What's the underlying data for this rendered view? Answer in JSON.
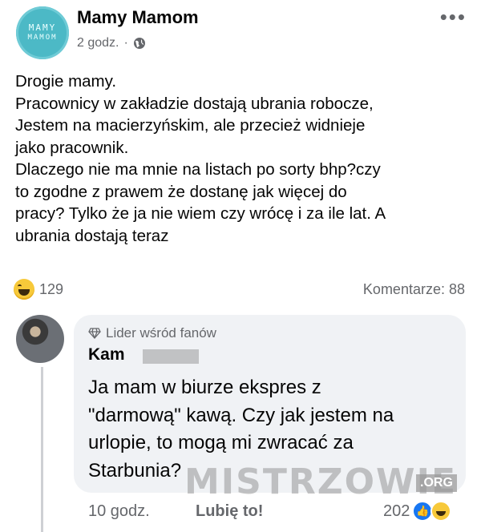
{
  "post": {
    "page_logo_top": "MAMY",
    "page_logo_bottom": "MAMOM",
    "page_name": "Mamy Mamom",
    "time": "2 godz.",
    "separator": "·",
    "more_label": "•••",
    "text_lines": [
      "Drogie mamy.",
      "Pracownicy w zakładzie dostają ubrania robocze,",
      "Jestem na macierzyńskim, ale przecież widnieje",
      "jako pracownik.",
      "Dlaczego nie ma mnie na listach po sorty bhp?czy",
      "to zgodne z prawem że dostanę jak więcej do",
      "pracy? Tylko że ja nie wiem czy wrócę i za ile lat. A",
      "ubrania dostają teraz"
    ],
    "reaction_count": "129",
    "comments_label": "Komentarze: 88"
  },
  "comment": {
    "badge": "Lider wśród fanów",
    "author": "Kam",
    "text_lines": [
      "Ja mam w biurze ekspres z",
      "\"darmową\" kawą. Czy jak jestem na",
      "urlopie, to mogą mi zwracać za",
      "Starbunia?"
    ],
    "time": "10 godz.",
    "like_label": "Lubię to!",
    "reaction_count": "202"
  },
  "watermark": {
    "text": "MISTRZOWIE",
    "suffix": ".ORG"
  },
  "colors": {
    "secondary_text": "#65676b",
    "bubble_bg": "#f0f2f5",
    "logo_bg": "#4cb9c6",
    "like_blue": "#1877f2"
  }
}
